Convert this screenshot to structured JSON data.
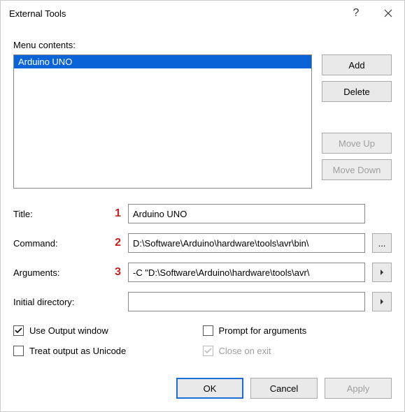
{
  "window": {
    "title": "External Tools"
  },
  "menu_contents_label": "Menu contents:",
  "list": {
    "items": [
      "Arduino UNO"
    ],
    "selected_index": 0
  },
  "buttons": {
    "add": "Add",
    "delete": "Delete",
    "move_up": "Move Up",
    "move_down": "Move Down",
    "ok": "OK",
    "cancel": "Cancel",
    "apply": "Apply",
    "browse": "..."
  },
  "markers": {
    "title": "1",
    "command": "2",
    "arguments": "3"
  },
  "fields": {
    "title": {
      "label": "Title:",
      "value": "Arduino UNO"
    },
    "command": {
      "label": "Command:",
      "value": "D:\\Software\\Arduino\\hardware\\tools\\avr\\bin\\"
    },
    "arguments": {
      "label": "Arguments:",
      "value": "-C \"D:\\Software\\Arduino\\hardware\\tools\\avr\\"
    },
    "initial_dir": {
      "label": "Initial directory:",
      "value": ""
    }
  },
  "checks": {
    "use_output": {
      "label": "Use Output window",
      "checked": true
    },
    "prompt_args": {
      "label": "Prompt for arguments",
      "checked": false
    },
    "treat_unicode": {
      "label": "Treat output as Unicode",
      "checked": false
    },
    "close_exit": {
      "label": "Close on exit",
      "checked": true,
      "disabled": true
    }
  }
}
